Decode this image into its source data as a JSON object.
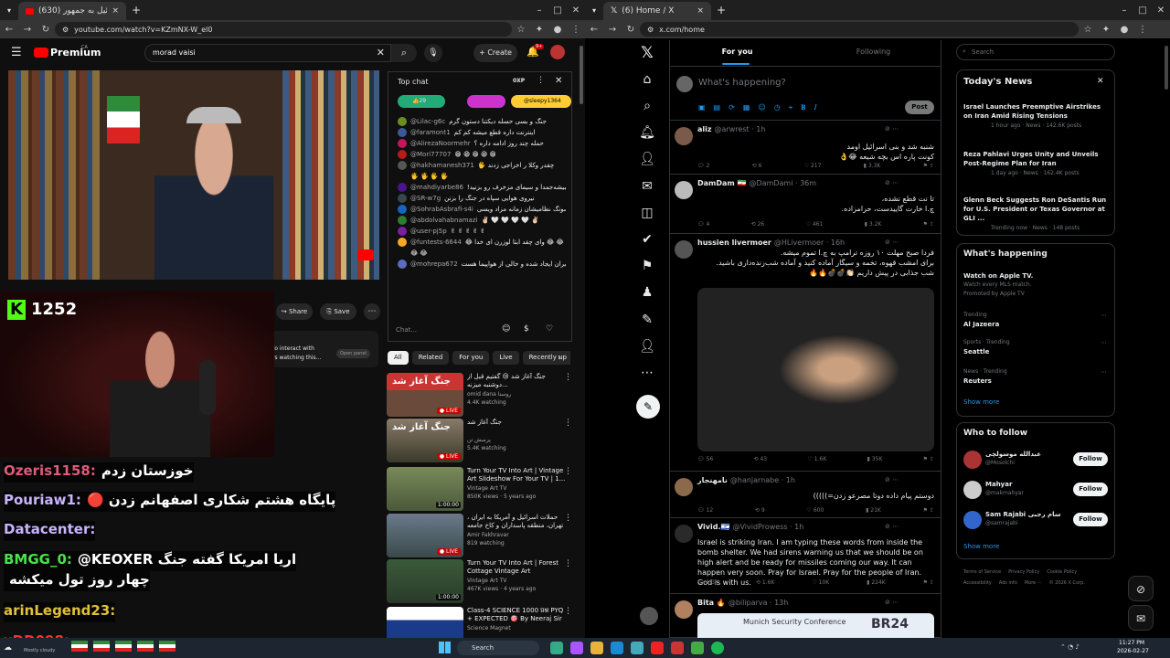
{
  "youtube": {
    "tab_title": "(630) حمله اسرائیل به جمهور",
    "url": "youtube.com/watch?v=KZmNX-W_el0",
    "logo": "Premium",
    "region": "CA",
    "search_value": "morad vaisi",
    "create_label": "Create",
    "notif_count": "9+",
    "share_label": "Share",
    "save_label": "Save",
    "open_panel_label": "Open panel",
    "interact_text": "to interact with",
    "watching_text": "rs watching this...",
    "chat": {
      "title": "Top chat",
      "xp": "0XP",
      "badge_likes": "29",
      "badge_comments": "1",
      "top_user": "@sleepy1364",
      "placeholder": "Chat...",
      "messages": [
        {
          "user": "@Lilac-g6c",
          "text": "جنگ و بسی حسله دیکتنا دستون گرم",
          "color": "#6b8e23"
        },
        {
          "user": "@faramont1",
          "text": "اینترنت داره قطع میشه کم کم",
          "color": "#3b5998"
        },
        {
          "user": "@AlirezaNoormehr",
          "text": "حمله چند روز ادامه داره ؟",
          "color": "#c2185b"
        },
        {
          "user": "@Mori77707",
          "text": "😁 😁 😁 😁 😁",
          "color": "#b71c1c"
        },
        {
          "user": "@hakhamanesh371",
          "text": "چقدر وکلا ر اخراجی زدند 🖐",
          "color": "#555"
        },
        {
          "user": "",
          "text": "🖐 🖐 🖐 🖐",
          "color": ""
        },
        {
          "user": "@mahdiyarbe86",
          "text": "تبیشه‌جمدا و سیمای مزخرف رو بزنید!",
          "color": "#4a148c"
        },
        {
          "user": "@SR-w7g",
          "text": "نیروی هوایی سپاه در جنگ را بزنن",
          "color": "#37474f"
        },
        {
          "user": "@SohrabAsbrafi-s4i",
          "text": "سونگ نظامیشان زمانه مزاد ویسی",
          "color": "#1565c0"
        },
        {
          "user": "@abdolvahabnamazi",
          "text": "✌🏻 🤍 🤍 🤍 🤍 ✌🏻",
          "color": "#2e7d32"
        },
        {
          "user": "@user-pj5p",
          "text": "✌ ✌ ✌ ✌ ✌",
          "color": "#7b1fa2"
        },
        {
          "user": "@funtests-6644",
          "text": "😂 😂 وای چقد ابتا لوزرن ای خدا 😂",
          "color": "#f9a825"
        },
        {
          "user": "",
          "text": "😂 😂",
          "color": ""
        },
        {
          "user": "@mohrepa672",
          "text": "یک کورینور هوایی از اسرائیل تا ایران ایجاد شده و خالی از هواپیما هست",
          "color": "#5c6bc0"
        }
      ]
    },
    "chips": [
      "All",
      "Related",
      "For you",
      "Live",
      "Recently up"
    ],
    "videos": [
      {
        "title": "جنگ آغاز شد 😢 گفتیم قبل از دوشنبه میزنه...",
        "channel": "omid dana روستا",
        "meta": "4.4K watching",
        "live": true,
        "thumb_text": "جنگ آغاز شد"
      },
      {
        "title": "جنگ آغاز شد",
        "channel": "پرسش تن",
        "meta": "5.4K watching",
        "live": true,
        "thumb_text": "جنگ آغاز شد"
      },
      {
        "title": "Turn Your TV Into Art | Vintage Art Slideshow For Your TV | 1...",
        "channel": "Vintage Art TV",
        "meta": "850K views · 5 years ago",
        "live": false,
        "duration": "1:00:00"
      },
      {
        "title": "حملات اسرائیل و آمریکا به ایران ، تهران، منطقه پاسداران و کاخ جامعه ای را هدف ...",
        "channel": "Amir Fakhravar",
        "meta": "819 watching",
        "live": true
      },
      {
        "title": "Turn Your TV Into Art | Forest Cottage Vintage Art Slideshow...",
        "channel": "Vintage Art TV",
        "meta": "467K views · 4 years ago",
        "live": false,
        "duration": "1:00:00"
      },
      {
        "title": "Class-4 SCIENCE 1000 प्रश्न PYQ + EXPECTED 🎯 By Neeraj Sir ...",
        "channel": "Science Magnet",
        "meta": "",
        "live": false,
        "thumb_text": "SCIENCE"
      }
    ]
  },
  "overlay": {
    "viewer_count": "1252",
    "messages": [
      {
        "user": "Ozeris1158:",
        "text": "خوزستان زدم",
        "color": "#e05a7a"
      },
      {
        "user": "Pouriaw1:",
        "text": "🔴 پایگاه هشتم شکاری اصفهانم زدن",
        "color": "#c9b3ff"
      },
      {
        "user": "Datacenter:",
        "text": "",
        "color": "#c9b3ff"
      },
      {
        "user": "BMGG_0:",
        "text": "@KEOXER اریا امریکا گفته جنگ",
        "color": "#4be04b"
      },
      {
        "user": "",
        "text": "چهار روز تول میکشه",
        "color": ""
      },
      {
        "user": "arinLegend23:",
        "text": "",
        "color": "#e0c13a"
      },
      {
        "user": "xDD098:",
        "text": "",
        "color": "#ff3030"
      }
    ],
    "weather": "Mostly cloudy"
  },
  "x": {
    "tab_title": "(6) Home / X",
    "url": "x.com/home",
    "tabs": [
      "For you",
      "Following"
    ],
    "compose_placeholder": "What's happening?",
    "post_label": "Post",
    "search_placeholder": "Search",
    "tweets": [
      {
        "name": "aliz",
        "handle": "@arwrest · 1h",
        "text": [
          "شنبه شد و بنی اسرائیل اومد",
          "کونت پاره اس بچه شیعه 😂👌"
        ],
        "stats": [
          "2",
          "6",
          "217",
          "3.3K"
        ]
      },
      {
        "name": "DamDam 🇮🇷",
        "handle": "@DamDami · 36m",
        "text": [
          "تا نت قطع نشده،",
          "چ.ا خارت گاییدست، حرامزاده."
        ],
        "stats": [
          "4",
          "26",
          "461",
          "3.2K"
        ]
      },
      {
        "name": "hussien livermoer",
        "handle": "@HLivermoer · 16h",
        "text": [
          "فردا صبح مهلت ۱۰ روزه ترامپ به چ.ا تموم میشه.",
          "برای امشب قهوه، تخمه و سیگار آماده کنید و آماده شب‌زنده‌داری باشید.",
          "شب جذابی در پیش داریم 👏🏻💣💣🔥🔥"
        ],
        "stats": [
          "56",
          "43",
          "1.6K",
          "35K"
        ]
      },
      {
        "name": "نامهنجار",
        "handle": "@hanjarnabe · 1h",
        "text": [
          "دوستم پیام داده دوتا مصرعو زدن=)))))"
        ],
        "stats": [
          "12",
          "9",
          "600",
          "21K"
        ]
      },
      {
        "name": "Vivid.🇮🇱",
        "handle": "@VividProwess · 1h",
        "text": [
          "Israel is striking Iran. I am typing these words from inside the bomb shelter. We had sirens warning us that we should be on high alert and be ready for missiles coming our way. It can happen very soon. Pray for Israel. Pray for the people of Iran. God is with us."
        ],
        "stats": [
          "1.3K",
          "1.6K",
          "10K",
          "224K"
        ]
      },
      {
        "name": "Bita 🔥",
        "handle": "@biliparva · 13h",
        "text": [],
        "stats": []
      }
    ],
    "news_title": "Today's News",
    "news": [
      {
        "title": "Israel Launches Preemptive Airstrikes on Iran Amid Rising Tensions",
        "meta": "1 hour ago · News · 142.6K posts"
      },
      {
        "title": "Reza Pahlavi Urges Unity and Unveils Post-Regime Plan for Iran",
        "meta": "1 day ago · News · 162.4K posts"
      },
      {
        "title": "Glenn Beck Suggests Ron DeSantis Run for U.S. President or Texas Governor at GLI ...",
        "meta": "Trending now · News · 148 posts"
      }
    ],
    "happening_title": "What's happening",
    "trends": [
      {
        "ctx": "",
        "title": "Watch on Apple TV.",
        "sub": "Watch every MLS match.",
        "promo": "Promoted by Apple TV"
      },
      {
        "ctx": "Trending",
        "title": "Al Jazeera",
        "sub": "",
        "promo": ""
      },
      {
        "ctx": "Sports · Trending",
        "title": "Seattle",
        "sub": "",
        "promo": ""
      },
      {
        "ctx": "News · Trending",
        "title": "Reuters",
        "sub": "",
        "promo": ""
      }
    ],
    "show_more": "Show more",
    "who_title": "Who to follow",
    "who": [
      {
        "name": "عبدالله موسولچی",
        "handle": "@Mosolchi"
      },
      {
        "name": "Mahyar",
        "handle": "@makmahyar"
      },
      {
        "name": "Sam Rajabi سام رجبی",
        "handle": "@samrajabi"
      }
    ],
    "follow_label": "Follow",
    "footer": [
      "Terms of Service",
      "Privacy Policy",
      "Cookie Policy",
      "Accessibility",
      "Ads info",
      "More ···",
      "© 2026 X Corp."
    ],
    "card_text": "Munich Security Conference",
    "card_logo": "BR24"
  },
  "taskbar": {
    "search": "Search",
    "time": "11:27 PM",
    "date": "2026-02-27"
  }
}
